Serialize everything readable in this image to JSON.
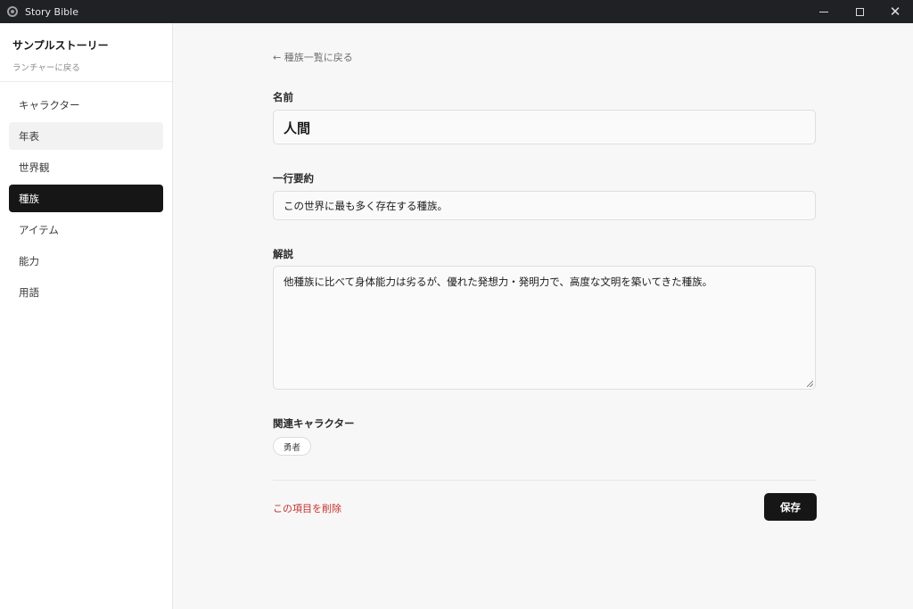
{
  "window": {
    "title": "Story Bible",
    "icon": "gear-icon",
    "controls": {
      "minimize": "minimize-icon",
      "maximize": "maximize-icon",
      "close": "close-icon"
    }
  },
  "sidebar": {
    "story_title": "サンプルストーリー",
    "launcher_link": "ランチャーに戻る",
    "items": [
      {
        "label": "キャラクター"
      },
      {
        "label": "年表"
      },
      {
        "label": "世界観"
      },
      {
        "label": "種族"
      },
      {
        "label": "アイテム"
      },
      {
        "label": "能力"
      },
      {
        "label": "用語"
      }
    ],
    "active_item": "種族"
  },
  "main": {
    "back_link": "← 種族一覧に戻る",
    "name": {
      "label": "名前",
      "value": "人間"
    },
    "summary": {
      "label": "一行要約",
      "value": "この世界に最も多く存在する種族。"
    },
    "description": {
      "label": "解説",
      "value": "他種族に比べて身体能力は劣るが、優れた発想力・発明力で、高度な文明を築いてきた種族。"
    },
    "related_characters": {
      "label": "関連キャラクター",
      "items": [
        "勇者"
      ]
    },
    "delete_link": "この項目を削除",
    "save_label": "保存"
  },
  "colors": {
    "titlebar": "#1f2124",
    "accent_dark": "#161616",
    "danger": "#c62f2f",
    "background": "#f7f7f7"
  }
}
